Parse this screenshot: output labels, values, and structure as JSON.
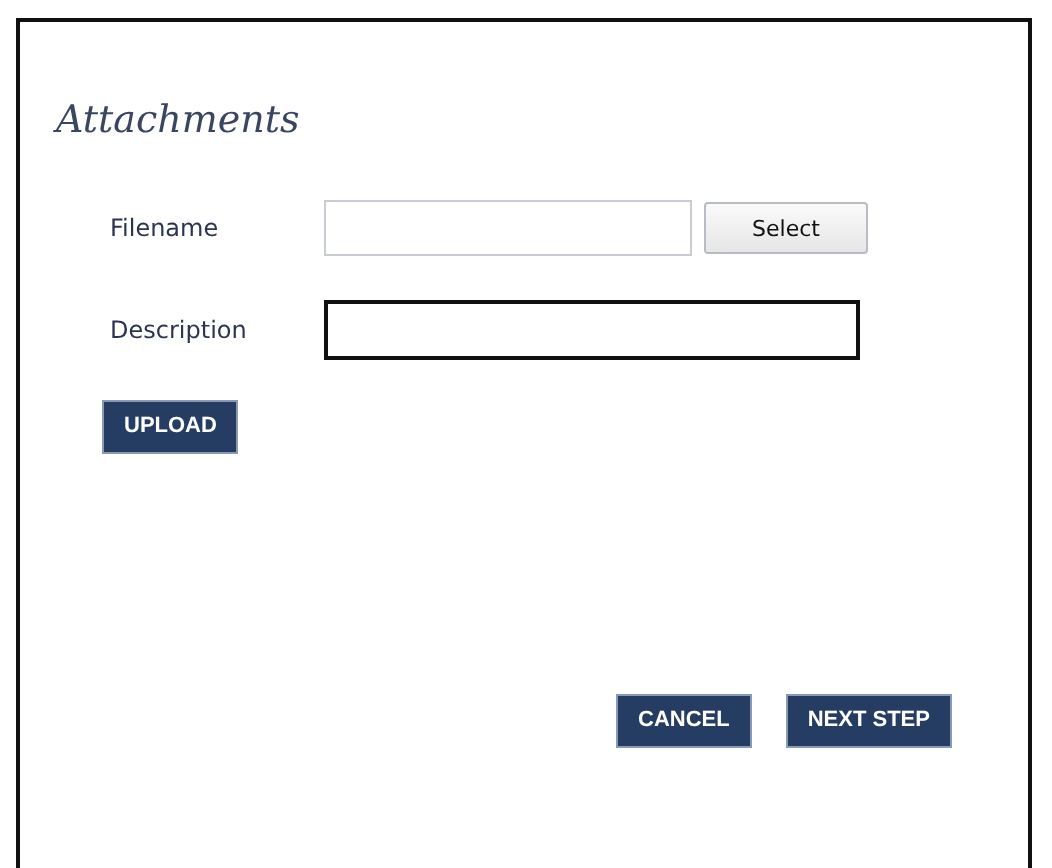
{
  "dialog": {
    "title": "Attachments",
    "fields": [
      {
        "kind": "file",
        "label": "Filename",
        "button": "Select"
      },
      {
        "kind": "text",
        "label": "Description"
      }
    ],
    "upload_button": "UPLOAD",
    "buttons": [
      "CANCEL",
      "NEXT STEP"
    ]
  }
}
